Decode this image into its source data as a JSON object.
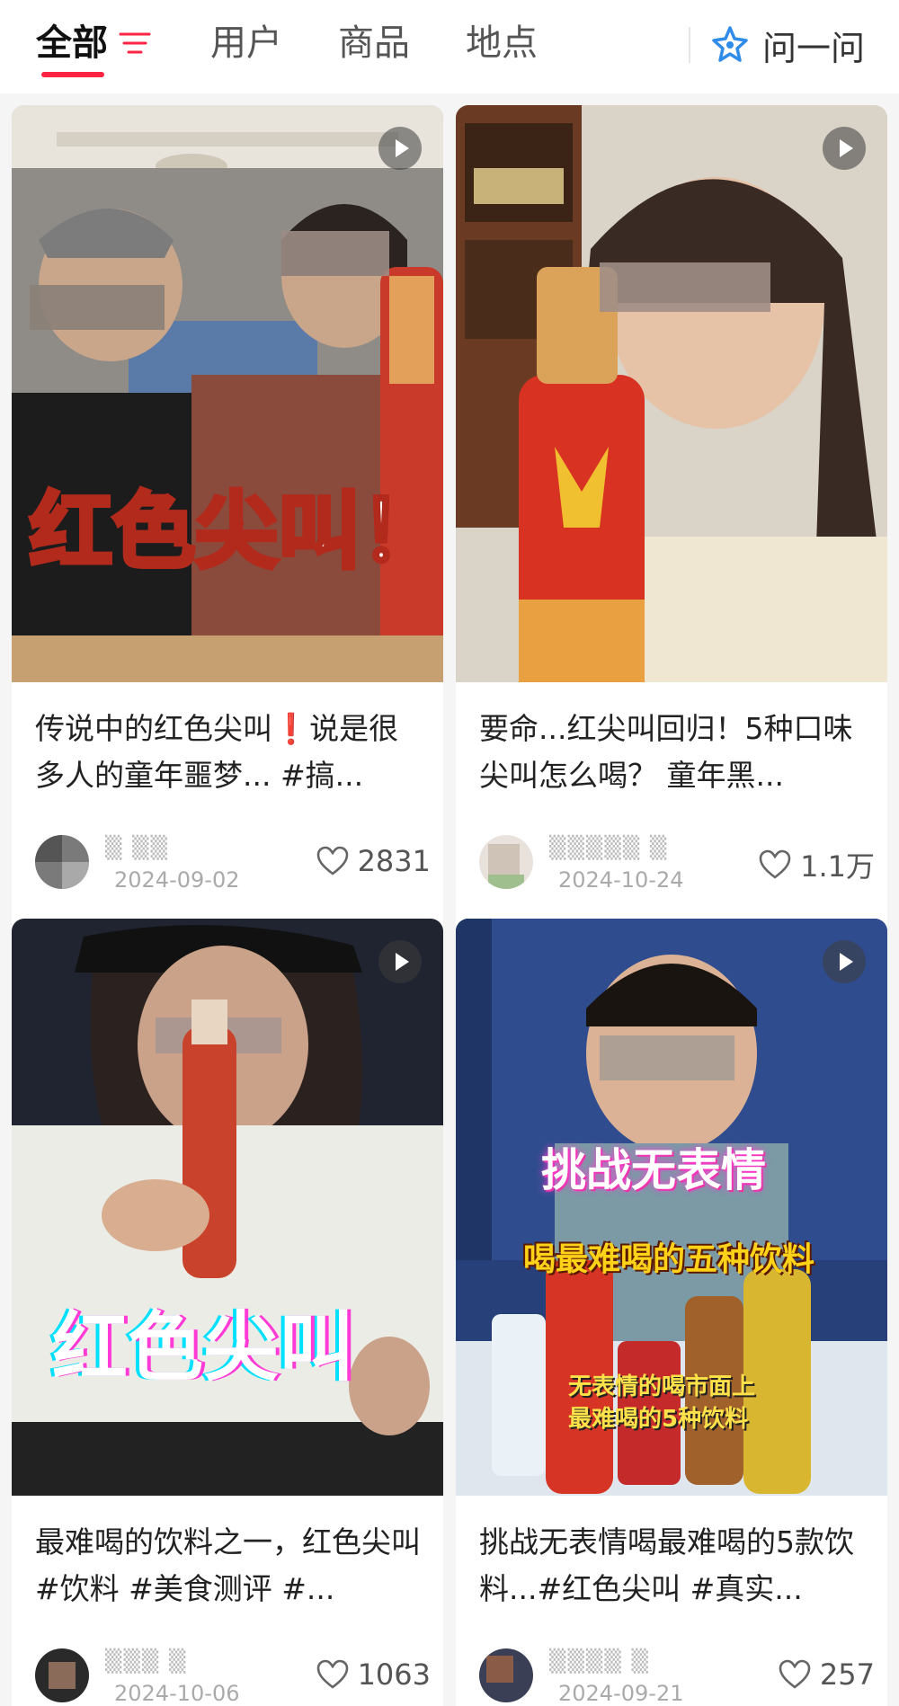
{
  "tabs": [
    {
      "label": "全部",
      "active": true
    },
    {
      "label": "用户",
      "active": false
    },
    {
      "label": "商品",
      "active": false
    },
    {
      "label": "地点",
      "active": false
    }
  ],
  "ask": {
    "label": "问一问",
    "icon": "ai-star-icon"
  },
  "accent_color": "#ff2442",
  "posts": [
    {
      "overlay": "红色尖叫！",
      "title": "传说中的红色尖叫❗️说是很多人的童年噩梦... #搞...",
      "date": "2024-09-02",
      "likes": "2831",
      "is_video": true
    },
    {
      "overlay": "",
      "title": "要命...红尖叫回归！5种口味尖叫怎么喝？ 童年黑...",
      "date": "2024-10-24",
      "likes": "1.1万",
      "is_video": true
    },
    {
      "overlay": "红色尖叫",
      "title": "最难喝的饮料之一，红色尖叫 #饮料  #美食测评  #...",
      "date": "2024-10-06",
      "likes": "1063",
      "is_video": true
    },
    {
      "overlay": "挑战无表情",
      "overlay2": "喝最难喝的五种饮料",
      "overlay3": "无表情的喝市面上",
      "overlay4": "最难喝的5种饮料",
      "title": "挑战无表情喝最难喝的5款饮料...#红色尖叫 #真实...",
      "date": "2024-09-21",
      "likes": "257",
      "is_video": true
    }
  ]
}
